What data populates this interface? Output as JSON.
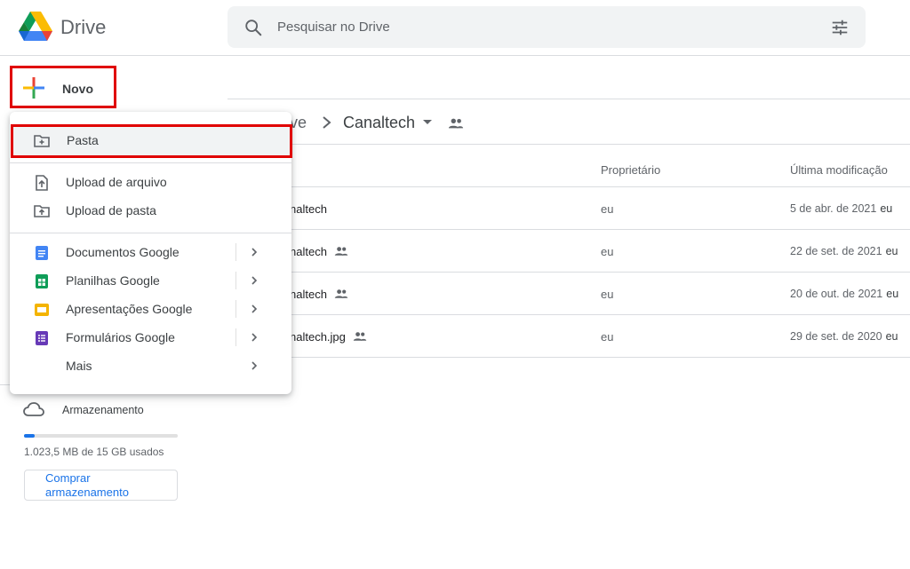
{
  "header": {
    "app_title": "Drive",
    "search_placeholder": "Pesquisar no Drive"
  },
  "new_button": {
    "label": "Novo"
  },
  "breadcrumb": {
    "previous_fragment": "ve",
    "current": "Canaltech"
  },
  "list": {
    "columns": {
      "owner": "Proprietário",
      "modified": "Última modificação"
    },
    "rows": [
      {
        "name": "naltech",
        "shared": false,
        "owner": "eu",
        "modified": "5 de abr. de 2021",
        "modified_by": "eu"
      },
      {
        "name": "naltech",
        "shared": true,
        "owner": "eu",
        "modified": "22 de set. de 2021",
        "modified_by": "eu"
      },
      {
        "name": "naltech",
        "shared": true,
        "owner": "eu",
        "modified": "20 de out. de 2021",
        "modified_by": "eu"
      },
      {
        "name": "naltech.jpg",
        "shared": true,
        "owner": "eu",
        "modified": "29 de set. de 2020",
        "modified_by": "eu"
      }
    ]
  },
  "menu": {
    "folder": "Pasta",
    "upload_file": "Upload de arquivo",
    "upload_folder": "Upload de pasta",
    "docs": "Documentos Google",
    "sheets": "Planilhas Google",
    "slides": "Apresentações Google",
    "forms": "Formulários Google",
    "more": "Mais"
  },
  "storage": {
    "label": "Armazenamento",
    "usage_text": "1.023,5 MB de 15 GB usados",
    "used_fraction": 0.067,
    "buy_line1": "Comprar",
    "buy_line2": "armazenamento"
  },
  "colors": {
    "accent": "#1a73e8",
    "highlight_border": "#e00000",
    "docs": "#4285f4",
    "sheets": "#0f9d58",
    "slides": "#f4b400",
    "forms": "#673ab7"
  },
  "icons": [
    "drive-logo-icon",
    "search-icon",
    "tune-icon",
    "plus-icon",
    "folder-plus-icon",
    "file-upload-icon",
    "folder-upload-icon",
    "docs-icon",
    "sheets-icon",
    "slides-icon",
    "forms-icon",
    "chevron-right-icon",
    "people-icon",
    "cloud-icon"
  ]
}
